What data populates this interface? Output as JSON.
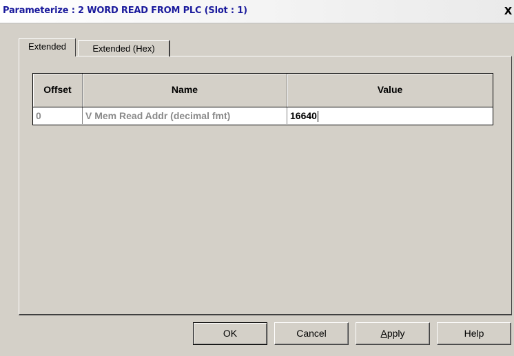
{
  "window": {
    "title": "Parameterize : 2 WORD READ FROM PLC (Slot : 1)",
    "close_label": "X"
  },
  "tabs": [
    {
      "label": "Extended",
      "active": true
    },
    {
      "label": "Extended (Hex)",
      "active": false
    }
  ],
  "grid": {
    "columns": [
      "Offset",
      "Name",
      "Value"
    ],
    "rows": [
      {
        "offset": "0",
        "name": "V Mem Read Addr (decimal fmt)",
        "value": "16640"
      }
    ]
  },
  "buttons": {
    "ok": "OK",
    "cancel": "Cancel",
    "apply": "Apply",
    "help": "Help"
  }
}
